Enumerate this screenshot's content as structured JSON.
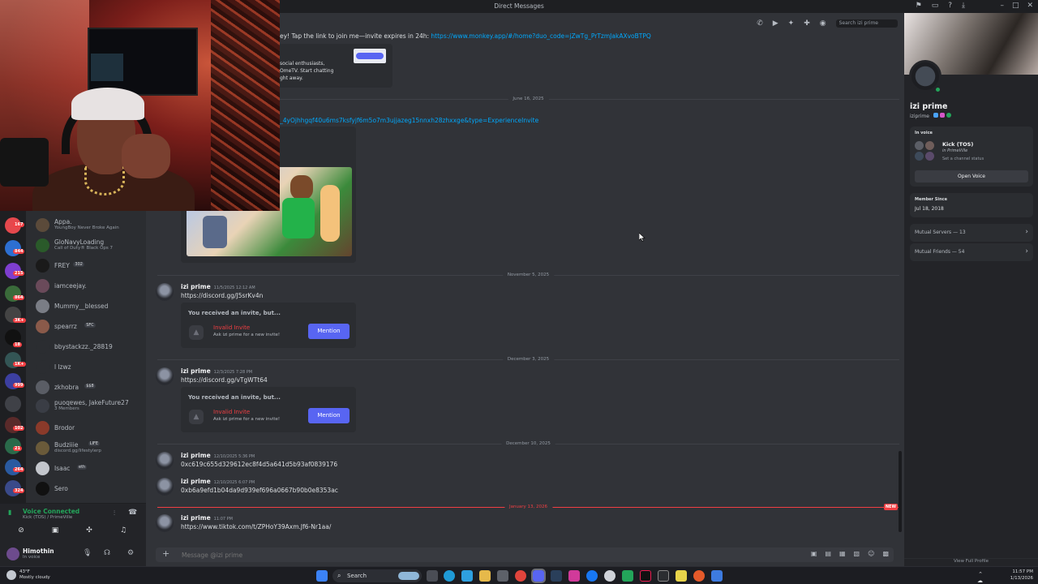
{
  "window": {
    "title": "Direct Messages",
    "search_placeholder": "Search izi prime"
  },
  "dm_list": [
    {
      "name": "Appa.",
      "sub": "YoungBoy Never Broke Again"
    },
    {
      "name": "GloNavyLoading",
      "sub": "Call of Duty® Black Ops 7"
    },
    {
      "name": "FREY",
      "sub": "",
      "tag": "302"
    },
    {
      "name": "iamceejay.",
      "sub": ""
    },
    {
      "name": "Mummy__blessed",
      "sub": ""
    },
    {
      "name": "spearrz",
      "sub": "",
      "tag": "SFC"
    },
    {
      "name": "bbystackzz._28819",
      "sub": ""
    },
    {
      "name": "l lzwz",
      "sub": ""
    },
    {
      "name": "zkhobra",
      "sub": "",
      "tag": "$$8"
    },
    {
      "name": "puoqɐwes, JakeFuture27",
      "sub": "3 Members"
    },
    {
      "name": "Brodor",
      "sub": ""
    },
    {
      "name": "Budziiie",
      "sub": "discord.gg/lifestylerp",
      "tag": "LIFE"
    },
    {
      "name": "Isaac",
      "sub": "",
      "tag": "eth"
    },
    {
      "name": "Sero",
      "sub": ""
    }
  ],
  "server_badges": [
    "167",
    "844",
    "215",
    "864",
    "3K+",
    "18",
    "1K+",
    "999",
    "102",
    "21",
    "264",
    "324"
  ],
  "voice": {
    "status": "Voice Connected",
    "channel": "Kick (TOS) / PrimeVille"
  },
  "user": {
    "name": "Himothin",
    "status": "In voice"
  },
  "chat": {
    "top_text": "ey! Tap the link to join me—invite expires in 24h:",
    "top_link": "https://www.monkey.app/#/home?duo_code=jZwTg_PrTzmJakAXvoBTPQ",
    "embed_lines": [
      "social enthusiasts,",
      "OmeTV. Start chatting",
      "ght away."
    ],
    "date_june": "June 16, 2025",
    "roblox_link": "_4yOjhhgqf40u6ms7ksfyjf6m5o7m3ujjazeg15nnxh28zhxxge&type=ExperienceInvite",
    "date_nov": "November 5, 2025",
    "date_dec3": "December 3, 2025",
    "date_dec10": "December 10, 2025",
    "date_jan": "January 13, 2026",
    "new_label": "NEW",
    "messages": [
      {
        "author": "izi prime",
        "time": "11/5/2025 12:12 AM",
        "text": "https://discord.gg/J5srKv4n",
        "is_link": true
      },
      {
        "author": "izi prime",
        "time": "12/3/2025 7:28 PM",
        "text": "https://discord.gg/vTgWTt64",
        "is_link": true
      },
      {
        "author": "izi prime",
        "time": "12/10/2025 5:36 PM",
        "text": "0xc619c655d329612ec8f4d5a641d5b93af0839176",
        "is_link": false
      },
      {
        "author": "izi prime",
        "time": "12/10/2025 6:07 PM",
        "text": "0xb6a9efd1b04da9d939ef696a0667b90b0e8353ac",
        "is_link": false
      },
      {
        "author": "izi prime",
        "time": "11:07 PM",
        "text": "https://www.tiktok.com/t/ZPHoY39Axm.Jf6-Nr1aa/",
        "is_link": true
      }
    ],
    "invite": {
      "header": "You received an invite, but...",
      "invalid": "Invalid Invite",
      "ask": "Ask izi prime for a new invite!",
      "button": "Mention"
    },
    "composer_placeholder": "Message @izi prime"
  },
  "profile": {
    "name": "izi prime",
    "username": "iziprime",
    "in_voice_label": "In voice",
    "channel": "Kick (TOS)",
    "server": "in PrimeVille",
    "set_status": "Set a channel status",
    "open_voice": "Open Voice",
    "member_since_label": "Member Since",
    "member_since": "Jul 18, 2018",
    "mutual_servers": "Mutual Servers — 13",
    "mutual_friends": "Mutual Friends — 54",
    "view_full": "View Full Profile"
  },
  "taskbar": {
    "search": "Search",
    "weather_temp": "43°F",
    "weather_desc": "Mostly cloudy",
    "time": "11:57 PM",
    "date": "1/13/2026"
  },
  "colors": {
    "accent": "#5865f2",
    "online": "#23a55a",
    "danger": "#f23f43",
    "link": "#00a8fc"
  }
}
